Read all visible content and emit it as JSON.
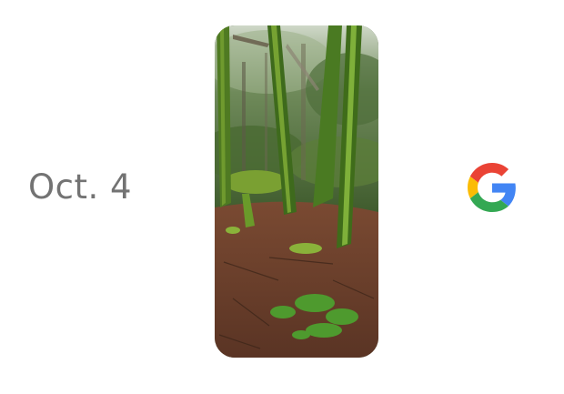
{
  "event": {
    "date_label": "Oct. 4"
  },
  "logo": {
    "icon": "google-g-icon",
    "colors": {
      "blue": "#4285F4",
      "red": "#EA4335",
      "yellow": "#FBBC05",
      "green": "#34A853"
    }
  },
  "phone": {
    "wallpaper": "forest-photo"
  }
}
